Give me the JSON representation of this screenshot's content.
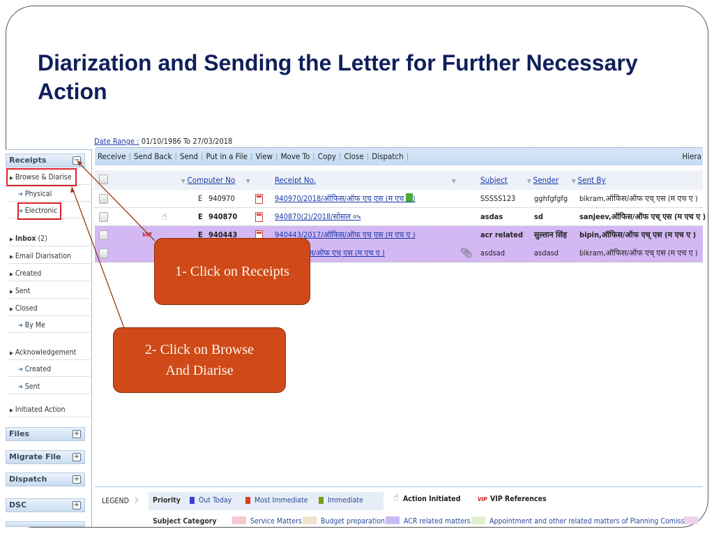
{
  "slide": {
    "title": "Diarization and Sending the Letter for Further Necessary Action"
  },
  "date_range": {
    "label": "Date Range :",
    "value": "01/10/1986 To 27/03/2018"
  },
  "sidebar": {
    "receipts_header": "Receipts",
    "receipts_toggle": "−",
    "items": [
      {
        "label": "Browse & Diarise",
        "type": "parent"
      },
      {
        "label": "Physical",
        "type": "sub"
      },
      {
        "label": "Electronic",
        "type": "sub"
      },
      {
        "label": "Inbox",
        "count": "(2)",
        "type": "parent"
      },
      {
        "label": "Email Diarisation",
        "type": "parent"
      },
      {
        "label": "Created",
        "type": "parent"
      },
      {
        "label": "Sent",
        "type": "parent"
      },
      {
        "label": "Closed",
        "type": "parent"
      },
      {
        "label": "By Me",
        "type": "sub"
      },
      {
        "label": "Acknowledgement",
        "type": "parent"
      },
      {
        "label": "Created",
        "type": "sub"
      },
      {
        "label": "Sent",
        "type": "sub"
      },
      {
        "label": "Initiated Action",
        "type": "parent"
      }
    ],
    "panels": [
      {
        "label": "Files",
        "toggle": "+"
      },
      {
        "label": "Migrate File",
        "toggle": "+"
      },
      {
        "label": "Dispatch",
        "toggle": "+"
      },
      {
        "label": "DSC",
        "toggle": "+"
      }
    ]
  },
  "toolbar": {
    "buttons": [
      "Receive",
      "Send Back",
      "Send",
      "Put in a File",
      "View",
      "Move To",
      "Copy",
      "Close",
      "Dispatch"
    ],
    "right_label": "Hiera"
  },
  "grid": {
    "columns": [
      "Computer No",
      "Receipt No.",
      "Subject",
      "Sender",
      "Sent By"
    ],
    "rows": [
      {
        "type": "E",
        "computer_no": "940970",
        "receipt_no": "940970/2018/ऑफिस/ऑफ एच् एस (म एच ए )",
        "subject": "SSSSS123",
        "sender": "gghfgfgfg",
        "sent_by": "bikram,ऑफिस/ऑफ एच् एस (म एच ए )",
        "bold": false,
        "highlight": false,
        "vip": false,
        "action_initiated": false,
        "attachment": false
      },
      {
        "type": "E",
        "computer_no": "940870",
        "receipt_no": "940870(2)/2018/सोसल ०५",
        "subject": "asdas",
        "sender": "sd",
        "sent_by": "sanjeev,ऑफिस/ऑफ एच् एस (म एच ए )",
        "bold": true,
        "highlight": false,
        "vip": false,
        "action_initiated": true,
        "attachment": false
      },
      {
        "type": "E",
        "computer_no": "940443",
        "receipt_no": "940443/2017/ऑफिस/ऑफ एच् एस (म एच ए )",
        "subject": "acr related",
        "sender": "सुल्तान सिंह",
        "sent_by": "bipin,ऑफिस/ऑफ एच् एस (म एच ए )",
        "bold": true,
        "highlight": true,
        "vip": true,
        "action_initiated": false,
        "attachment": false
      },
      {
        "type": "",
        "computer_no": "",
        "receipt_no": "…17/ऑफिस/ऑफ एच् एस (म एच ए )",
        "subject": "asdsad",
        "sender": "asdasd",
        "sent_by": "bikram,ऑफिस/ऑफ एच् एस (म एच ए )",
        "bold": false,
        "highlight": true,
        "vip": false,
        "action_initiated": false,
        "attachment": true
      }
    ],
    "vip_tag": "VIP"
  },
  "callouts": [
    {
      "text": "1- Click on Receipts"
    },
    {
      "text": "2- Click on Browse And Diarise"
    }
  ],
  "legend": {
    "title": "LEGEND",
    "priority_label": "Priority",
    "priority_items": [
      {
        "label": "Out Today",
        "color": "#3a3fd0"
      },
      {
        "label": "Most Immediate",
        "color": "#d9401f"
      },
      {
        "label": "Immediate",
        "color": "#7a9a1a"
      }
    ],
    "action_initiated": "Action Initiated",
    "vip_tag": "VIP",
    "vip_references": "VIP References",
    "subject_category_label": "Subject Category",
    "subject_categories": [
      {
        "label": "Service Matters",
        "color": "#f7c9cf"
      },
      {
        "label": "Budget preparation",
        "color": "#f3e3cc"
      },
      {
        "label": "ACR related matters",
        "color": "#c9b9f3"
      },
      {
        "label": "Appointment and other related matters of Planning Comission",
        "color": "#e1efcf"
      },
      {
        "label": "",
        "color": "#efd2ea"
      }
    ]
  },
  "colors": {
    "title": "#0f1f5a",
    "callout_bg": "#cf4a18",
    "highlight_row": "#d3b8f4",
    "link": "#1a3aa8",
    "annotation_box": "#e0202a"
  }
}
